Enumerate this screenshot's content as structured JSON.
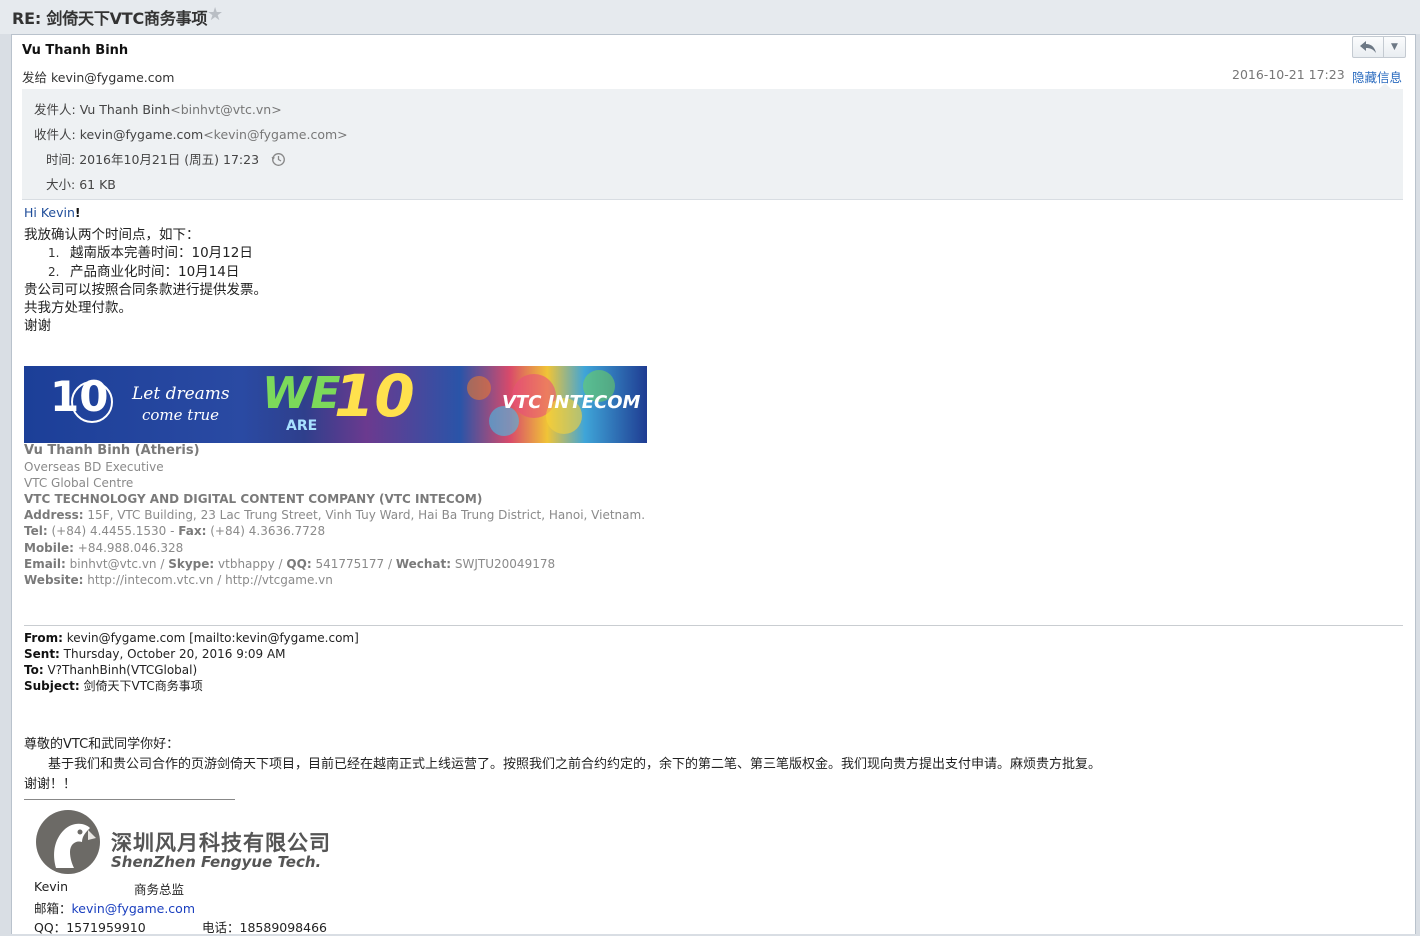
{
  "subject": "RE: 剑倚天下VTC商务事项",
  "header": {
    "sender_name": "Vu Thanh Binh",
    "to_line": "发给 kevin@fygame.com",
    "date": "2016-10-21 17:23",
    "hide_info": "隐藏信息"
  },
  "meta": {
    "from_label": "发件人:",
    "from_name": "Vu Thanh Binh",
    "from_addr": "<binhvt@vtc.vn>",
    "to_label": "收件人:",
    "to_name": "kevin@fygame.com",
    "to_addr": "<kevin@fygame.com>",
    "time_label": "时间:",
    "time_value": "2016年10月21日 (周五) 17:23",
    "size_label": "大小:",
    "size_value": "61 KB"
  },
  "body": {
    "greeting": "Hi Kevin",
    "greeting_mark": "!",
    "line1": "我放确认两个时间点，如下：",
    "item1_num": "1.",
    "item1": "越南版本完善时间：10月12日",
    "item2_num": "2.",
    "item2": "产品商业化时间：10月14日",
    "line2": "贵公司可以按照合同条款进行提供发票。",
    "line3": "共我方处理付款。",
    "line4": "谢谢"
  },
  "banner": {
    "ten": "10",
    "slogan1": "Let dreams",
    "slogan2": "come true",
    "we": "WE",
    "are": "ARE",
    "ten2": "10",
    "brand": "VTC INTECOM"
  },
  "signature": {
    "name": "Vu Thanh Binh (Atheris)",
    "title": "Overseas BD Executive",
    "centre": "VTC Global Centre",
    "company": "VTC TECHNOLOGY AND DIGITAL CONTENT COMPANY (VTC INTECOM)",
    "address_label": "Address:",
    "address": " 15F, VTC Building, 23 Lac Trung Street, Vinh Tuy Ward, Hai Ba Trung District, Hanoi, Vietnam.",
    "tel_label": "Tel:",
    "tel": " (+84) 4.4455.1530 - ",
    "fax_label": "Fax:",
    "fax": " (+84) 4.3636.7728",
    "mobile_label": "Mobile:",
    "mobile": " +84.988.046.328",
    "email_label": "Email:",
    "email": " binhvt@vtc.vn / ",
    "skype_label": "Skype:",
    "skype": " vtbhappy / ",
    "qq_label": "QQ:",
    "qq": " 541775177 / ",
    "wechat_label": "Wechat:",
    "wechat": " SWJTU20049178",
    "website_label": "Website:",
    "website": " http://intecom.vtc.vn / http://vtcgame.vn"
  },
  "original": {
    "from_label": "From:",
    "from": " kevin@fygame.com [mailto:kevin@fygame.com]",
    "sent_label": "Sent:",
    "sent": " Thursday, October 20, 2016 9:09 AM",
    "to_label": "To:",
    "to": " V?ThanhBinh(VTCGlobal)",
    "subject_label": "Subject:",
    "subject": " 剑倚天下VTC商务事项"
  },
  "original_body": {
    "salutation": "尊敬的VTC和武同学你好：",
    "para": "基于我们和贵公司合作的页游剑倚天下项目，目前已经在越南正式上线运营了。按照我们之前合约约定的，余下的第二笔、第三笔版权金。我们现向贵方提出支付申请。麻烦贵方批复。",
    "thanks": "谢谢！！"
  },
  "company_logo": {
    "cn": "深圳风月科技有限公司",
    "en": "ShenZhen Fengyue Tech."
  },
  "contact": {
    "name": "Kevin",
    "role": "商务总监",
    "email_label": "邮箱：",
    "email": "kevin@fygame.com",
    "qq_label": "QQ：",
    "qq": "1571959910",
    "phone_label": "电话：",
    "phone": "18589098466"
  },
  "icons": [
    "star-icon",
    "reply-icon",
    "dropdown-icon",
    "clock-icon"
  ]
}
